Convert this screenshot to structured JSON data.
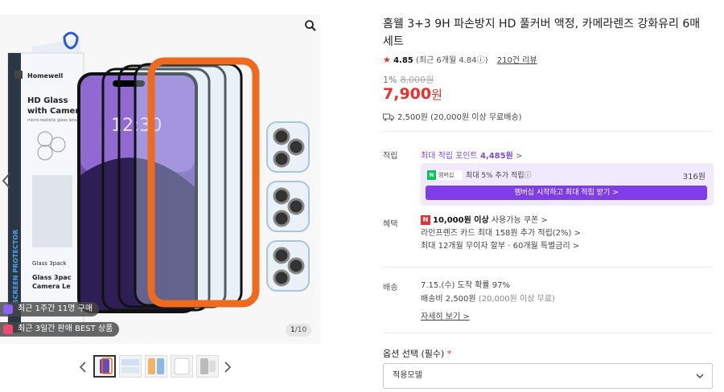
{
  "gallery": {
    "counter_current": "1",
    "counter_total": "/10",
    "badge_recent_purchases": "최근 1주간 11명 구매",
    "badge_best_seller": "최근 3일간 판매 BEST 상품",
    "box_brand": "Homewell",
    "box_heading": "HD Glass with Camera",
    "box_subtext": "micro-realistic glass lens",
    "box_side_text": "SCREEN PROTECTOR",
    "box_pack": "Glass 3pack",
    "box_pack2": "Glass 3pack Camera Le",
    "phone_time": "12:30"
  },
  "product": {
    "title": "홈웰 3+3 9H 파손방지 HD 풀커버 액정, 카메라렌즈 강화유리 6매 세트",
    "rating_star": "★",
    "rating_score": "4.85",
    "rating_recent": "(최근 6개월 4.84ⓘ)",
    "review_count": "210건 리뷰",
    "discount_rate": "1%",
    "original_price": "8,000원",
    "price_value": "7,900",
    "price_unit": "원",
    "shipping_fee": "2,500원 (20,000원 이상 무료배송)"
  },
  "points": {
    "label": "적립",
    "link_prefix": "최대 적립 포인트",
    "link_amount": "4,485원",
    "link_chevron": ">",
    "membership_logo_n": "N",
    "membership_logo_text": "멤버십",
    "membership_text": "최대 5% 추가 적립ⓘ",
    "membership_amount": "316원",
    "membership_button": "멤버십 시작하고 최대 적립 받기 >"
  },
  "benefits": {
    "label": "혜택",
    "n_mark": "N",
    "coupon_amount": "10,000원 이상",
    "coupon_rest": " 사용가능 쿠폰 >",
    "card_points": "라인프렌즈 카드 최대 158원 추가 적립(2%) >",
    "installment": "최대 12개월 무이자 할부 · 60개월 특별금리 >"
  },
  "delivery": {
    "label": "배송",
    "arrival": "7.15.(수) 도착 확률 97%",
    "fee_prefix": "배송비 2,500원",
    "fee_note": " (20,000원 이상 무료)",
    "detail_link": "자세히 보기 >"
  },
  "option": {
    "label": "옵션 선택 (필수)",
    "required_mark": "*",
    "select_value": "적용모델"
  },
  "colors": {
    "price_red": "#e8312f",
    "membership_purple": "#7f3ce8",
    "phone_frame_orange": "#ee6a1f"
  }
}
